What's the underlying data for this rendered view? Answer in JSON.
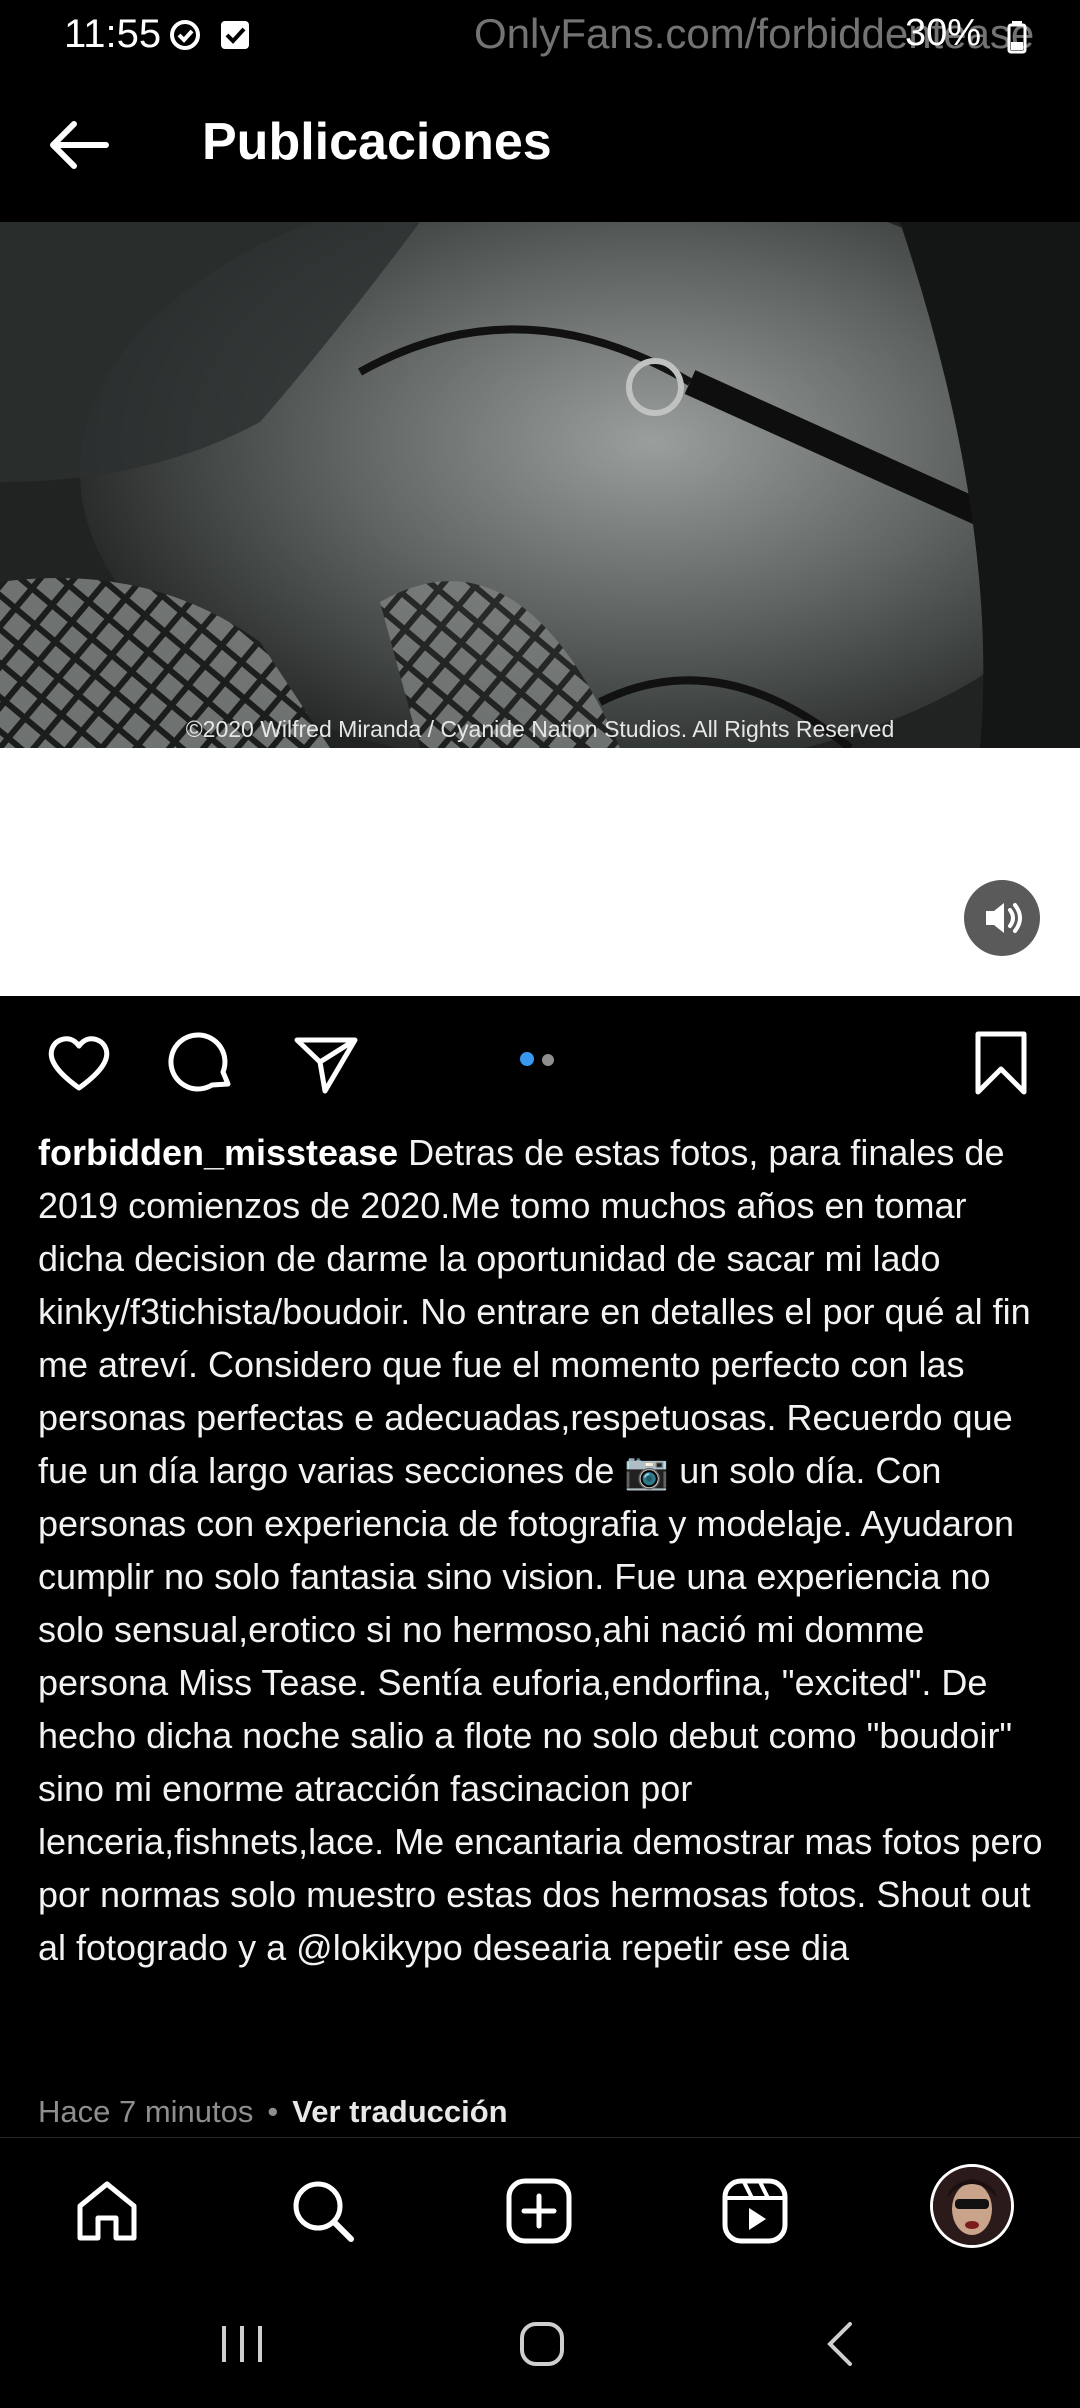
{
  "status_bar": {
    "time": "11:55",
    "watermark": "OnlyFans.com/forbiddentease",
    "battery": "30%"
  },
  "header": {
    "title": "Publicaciones"
  },
  "post": {
    "photo_credit": "©2020 Wilfred Miranda / Cyanide Nation Studios. All Rights Reserved",
    "carousel": {
      "count": 2,
      "active": 1
    },
    "username": "forbidden_misstease",
    "caption_before_emoji": "Detras de estas fotos, para finales de 2019 comienzos de 2020.Me tomo muchos años en tomar dicha decision de darme la oportunidad de sacar mi lado kinky/f3tichista/boudoir. No entrare en detalles el por qué al fin me atreví. Considero que fue el momento perfecto con las personas perfectas e adecuadas,respetuosas. Recuerdo que fue un día largo varias secciones de",
    "caption_emoji": "📷",
    "caption_after_emoji": "un solo día. Con personas con experiencia de fotografia y modelaje. Ayudaron cumplir no solo fantasia sino vision. Fue una experiencia no solo sensual,erotico si no hermoso,ahi nació mi domme persona Miss Tease. Sentía euforia,endorfina, \"excited\". De hecho dicha noche salio a flote no solo debut como \"boudoir\" sino mi enorme atracción  fascinacion por lenceria,fishnets,lace. Me encantaria demostrar mas fotos pero por normas solo muestro estas dos hermosas fotos.  Shout out al fotogrado y a @lokikypo desearia repetir ese dia",
    "timestamp": "Hace 7 minutos",
    "separator": "•",
    "translate_label": "Ver traducción"
  },
  "colors": {
    "background": "#000000",
    "active_dot": "#3897f0",
    "inactive_dot": "#8e8e8e",
    "meta_text": "#8e8e8e"
  },
  "icons": {
    "back": "arrow-left-icon",
    "like": "heart-icon",
    "comment": "comment-icon",
    "share": "send-icon",
    "save": "bookmark-icon",
    "sound": "speaker-icon",
    "nav": [
      "home-icon",
      "search-icon",
      "create-icon",
      "reels-icon",
      "profile-avatar"
    ]
  }
}
